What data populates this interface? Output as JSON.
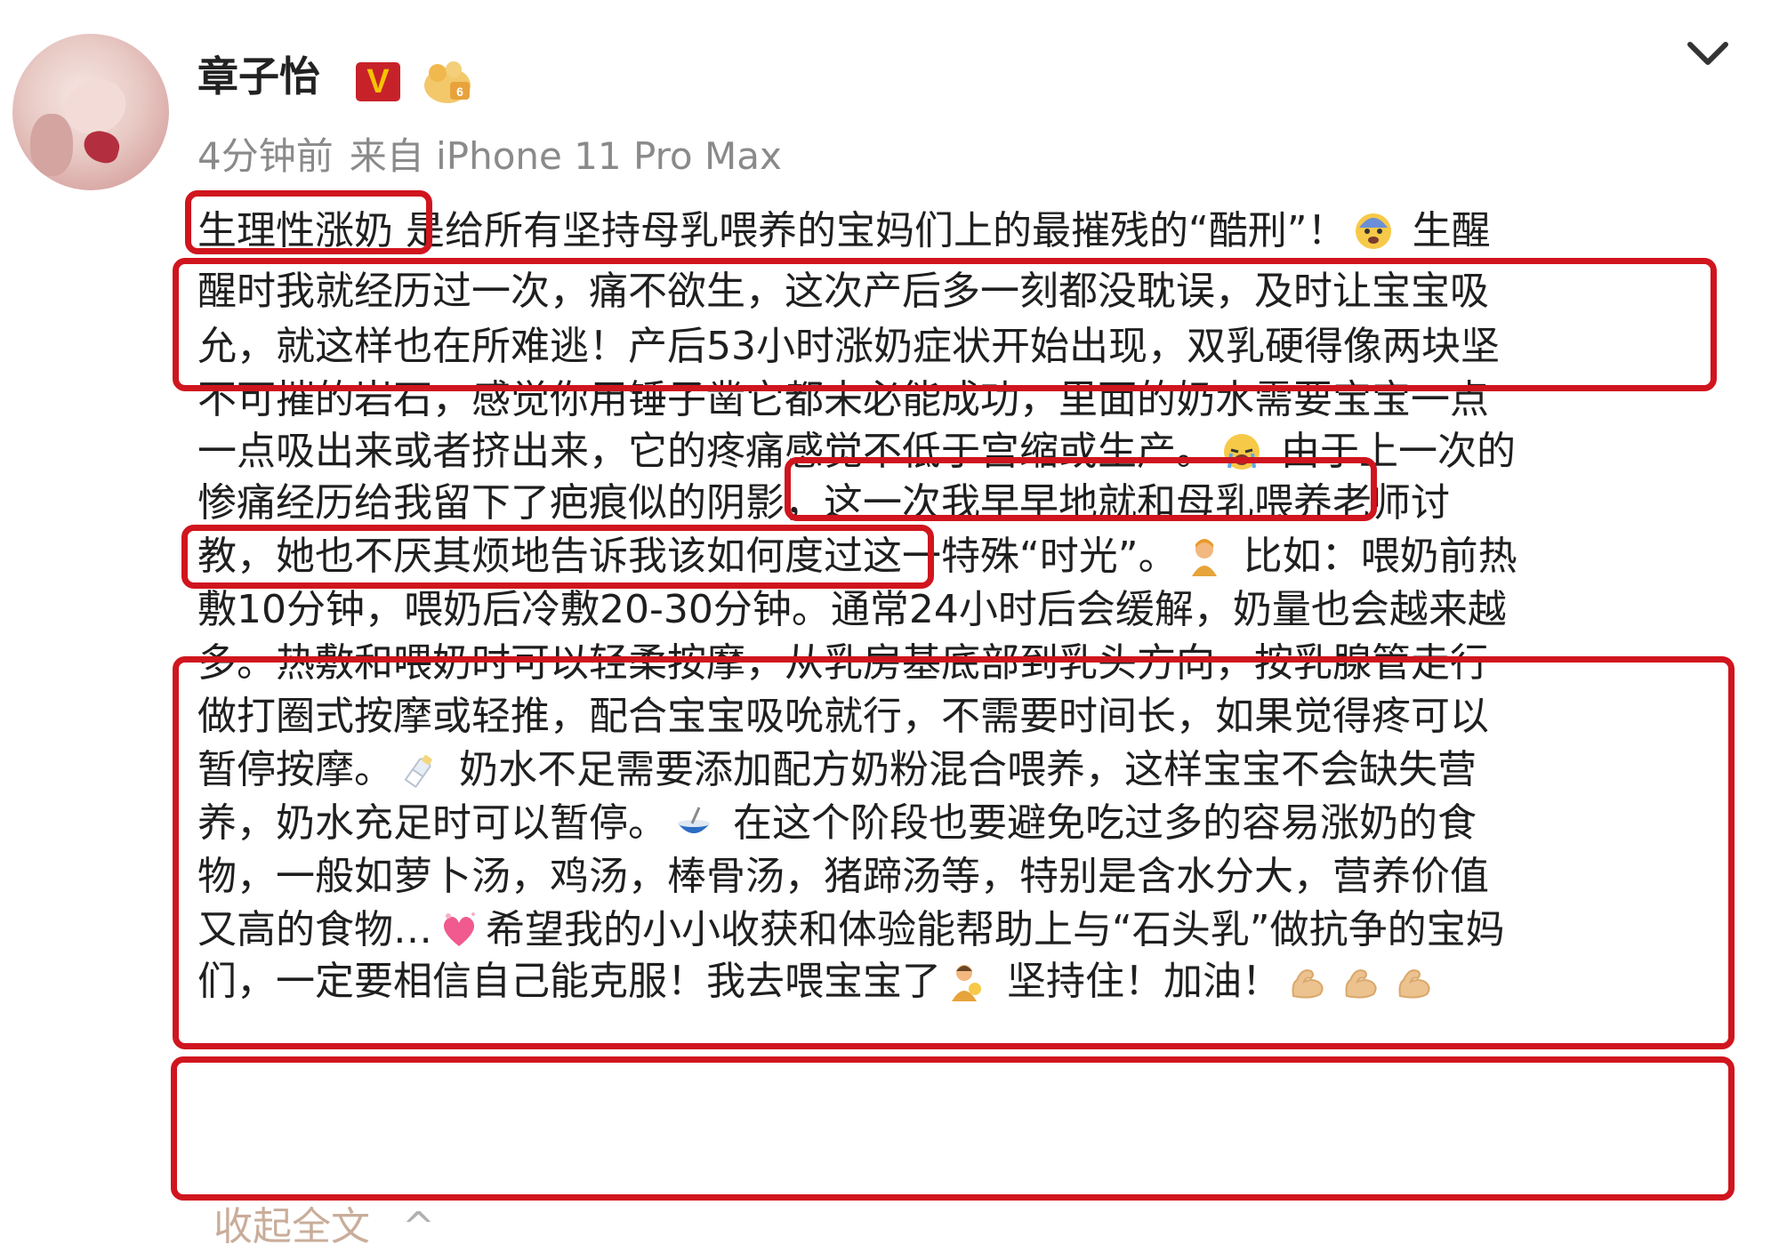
{
  "post": {
    "author_name": "章子怡",
    "verified_badge": "V",
    "timestamp": "4分钟前",
    "source": "来自 iPhone 11 Pro Max",
    "lines": [
      {
        "segments": [
          {
            "t": "生理性涨奶"
          },
          {
            "t": " 是给所有坚持母乳喂养的宝妈们上的最摧残的“酷刑”！"
          },
          {
            "emoji": "fearful-face-emoji"
          },
          {
            "t": " 生醒"
          }
        ]
      },
      {
        "segments": [
          {
            "t": "醒时我就经历过一次，痛不欲生，这次产后多一刻都没耽误，及时让宝宝吸"
          }
        ]
      },
      {
        "segments": [
          {
            "t": "允，就这样也在所难逃！产后53小时涨奶症状开始出现，双乳硬得像两块坚"
          }
        ]
      },
      {
        "segments": [
          {
            "t": "不可摧的岩石，感觉你用锤子凿它都未必能成功，里面的奶水需要宝宝一点"
          }
        ]
      },
      {
        "segments": [
          {
            "t": "一点吸出来或者挤出来，它的疼痛感觉不低于宫缩或生产。"
          },
          {
            "emoji": "crying-face-emoji"
          },
          {
            "t": " 由于上一次的"
          }
        ]
      },
      {
        "segments": [
          {
            "t": "惨痛经历给我留下了疤痕似的阴影，这一次我早早地就和母乳喂养老师讨"
          }
        ]
      },
      {
        "segments": [
          {
            "t": "教，她也不厌其烦地告诉我该如何度过这一特殊“时光”。"
          },
          {
            "emoji": "person-emoji"
          },
          {
            "t": " 比如：喂奶前热"
          }
        ]
      },
      {
        "segments": [
          {
            "t": "敷10分钟，喂奶后冷敷20-30分钟。通常24小时后会缓解，奶量也会越来越"
          }
        ]
      },
      {
        "segments": [
          {
            "t": "多。热敷和喂奶时可以轻柔按摩，从乳房基底部到乳头方向，按乳腺管走行"
          }
        ]
      },
      {
        "segments": [
          {
            "t": "做打圈式按摩或轻推，配合宝宝吸吮就行，不需要时间长，如果觉得疼可以"
          }
        ]
      },
      {
        "segments": [
          {
            "t": "暂停按摩。"
          },
          {
            "emoji": "baby-bottle-emoji"
          },
          {
            "t": " 奶水不足需要添加配方奶粉混合喂养，这样宝宝不会缺失营"
          }
        ]
      },
      {
        "segments": [
          {
            "t": "养，奶水充足时可以暂停。"
          },
          {
            "emoji": "bowl-emoji"
          },
          {
            "t": " 在这个阶段也要避免吃过多的容易涨奶的食"
          }
        ]
      },
      {
        "segments": [
          {
            "t": "物，一般如萝卜汤，鸡汤，棒骨汤，猪蹄汤等，特别是含水分大，营养价值"
          }
        ]
      },
      {
        "segments": [
          {
            "t": "又高的食物…"
          },
          {
            "emoji": "heart-emoji"
          },
          {
            "t": "希望我的小小收获和体验能帮助上与“石头乳”做抗争的宝妈"
          }
        ]
      },
      {
        "segments": [
          {
            "t": "们，一定要相信自己能克服！我去喂宝宝了"
          },
          {
            "emoji": "mother-feeding-emoji"
          },
          {
            "t": " 坚持住！加油！"
          },
          {
            "emoji": "flexed-biceps-emoji"
          },
          {
            "emoji": "flexed-biceps-emoji"
          },
          {
            "emoji": "flexed-biceps-emoji"
          }
        ]
      }
    ],
    "collapse_label": "收起全文",
    "collapse_caret": "^"
  },
  "colors": {
    "highlight": "#d0151e",
    "meta_text": "#8a8a8a",
    "badge_bg": "#c7222a",
    "badge_text": "#f5c400"
  },
  "icons": {
    "collapse_menu": "chevron-down-icon",
    "level": "level-badge-icon"
  }
}
